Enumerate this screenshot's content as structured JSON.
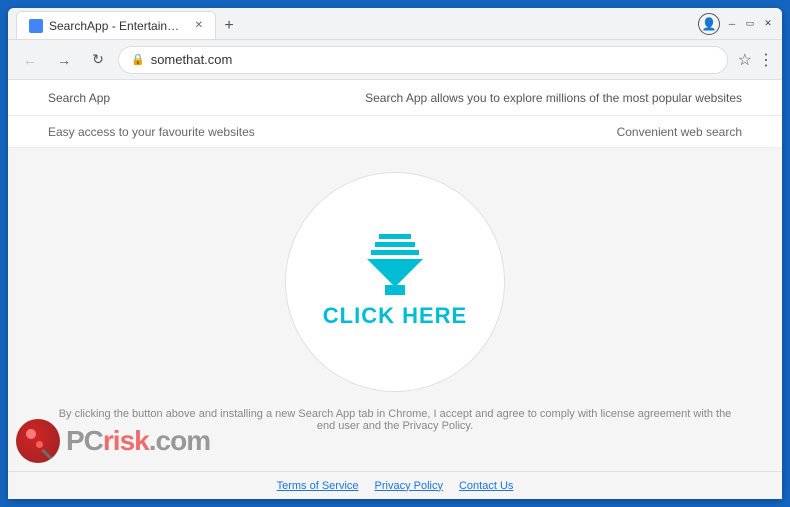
{
  "window": {
    "title": "SearchApp - Entertainm...",
    "tab_label": "SearchApp - Entertainm..."
  },
  "addressbar": {
    "url": "somethat.com"
  },
  "toolbar": {
    "app_name": "Search App",
    "app_description": "Search App allows you to explore millions of the most popular websites"
  },
  "features": {
    "left": "Easy access to your favourite websites",
    "right": "Convenient web search"
  },
  "cta": {
    "label": "CLICK HERE"
  },
  "disclaimer": {
    "text": "By clicking the button above and installing a new Search App tab in Chrome, I accept and agree to comply with license agreement with the end user and the Privacy Policy."
  },
  "footer": {
    "links": [
      "Terms of Service",
      "Privacy Policy",
      "Contact Us"
    ]
  },
  "watermark": {
    "text_gray": "PC",
    "text_red": "risk",
    "suffix": ".com"
  }
}
